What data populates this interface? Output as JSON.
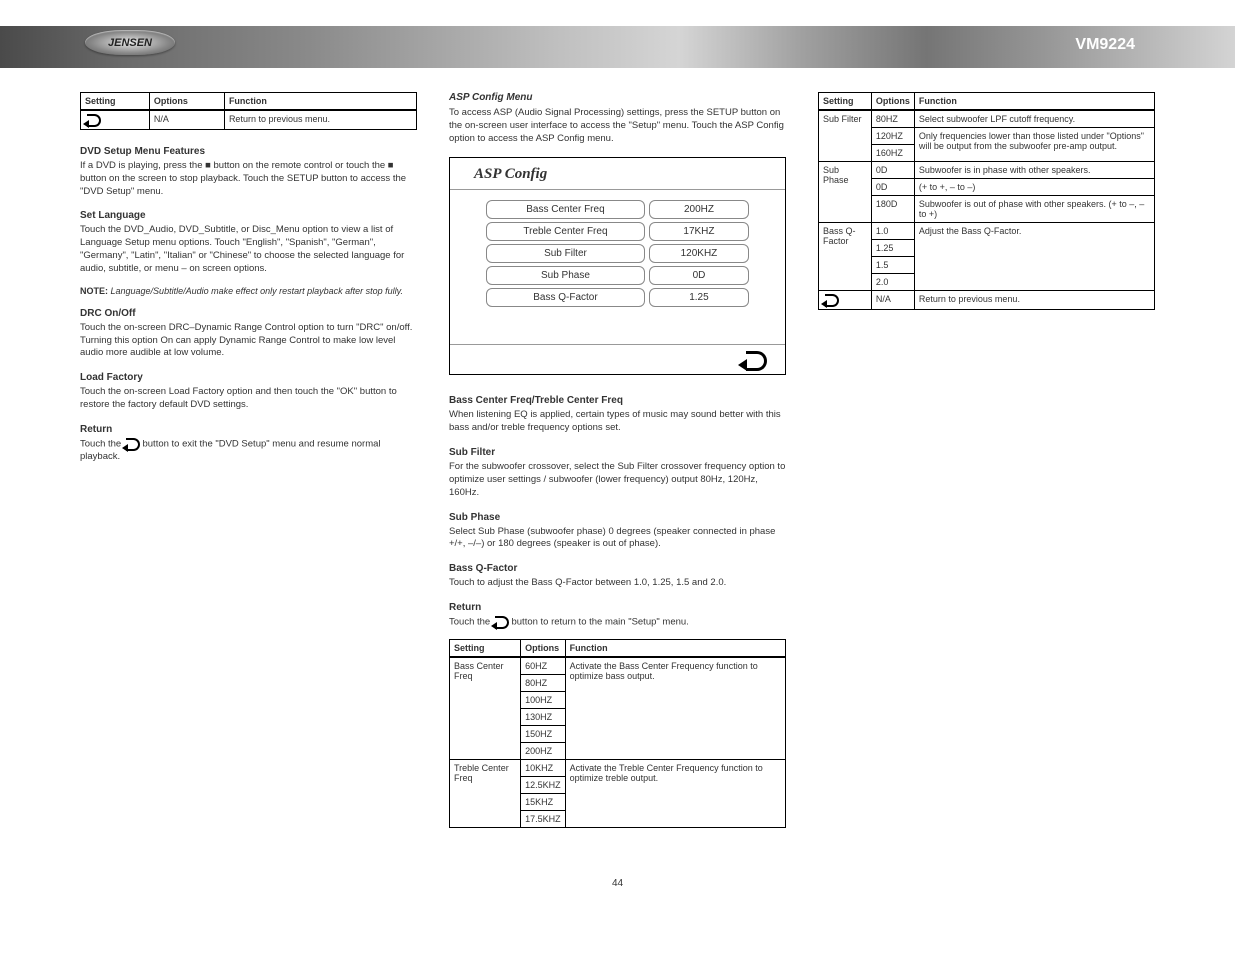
{
  "header": {
    "logo_text": "JENSEN",
    "product_code": "VM9224"
  },
  "page_number": "44",
  "col1": {
    "table_head": {
      "c1": "Setting",
      "c2": "Options",
      "c3": "Function"
    },
    "return_row": {
      "options": "N/A",
      "function": "Return to previous menu."
    },
    "dvd_title": "DVD Setup Menu Features",
    "dvd_intro": "If a DVD is playing, press the ■ button on the remote control or touch the ■ button on the screen to stop playback. Touch the SETUP button to access the \"DVD Setup\" menu.",
    "lang_title": "Set Language",
    "lang_desc": "Touch the DVD_Audio, DVD_Subtitle, or Disc_Menu option to view a list of Language Setup menu options. Touch \"English\", \"Spanish\", \"German\", \"Germany\", \"Latin\", \"Italian\" or \"Chinese\" to choose the selected language for audio, subtitle, or menu – on screen options.",
    "lang_note_label": "NOTE:",
    "lang_note": "Language/Subtitle/Audio make effect only restart playback after stop fully.",
    "drc_title": "DRC On/Off",
    "drc_desc": "Touch the on-screen DRC–Dynamic Range Control option to turn \"DRC\" on/off. Turning this option On can apply Dynamic Range Control to make low level audio more audible at low volume.",
    "load_title": "Load Factory",
    "load_desc": "Touch the on-screen Load Factory option and then touch the \"OK\" button to restore the factory default DVD settings.",
    "return_title": "Return",
    "return_text_1": "Touch the",
    "return_text_2": "button to exit the \"DVD Setup\" menu and resume normal playback."
  },
  "col2": {
    "asp_title_menu": "ASP Config Menu",
    "asp_intro": "To access ASP (Audio Signal Processing) settings, press the SETUP button on the on-screen user interface to access the \"Setup\" menu. Touch the ASP Config option to access the ASP Config menu.",
    "panel_title": "ASP Config",
    "rows": [
      {
        "label": "Bass Center Freq",
        "value": "200HZ"
      },
      {
        "label": "Treble Center Freq",
        "value": "17KHZ"
      },
      {
        "label": "Sub Filter",
        "value": "120KHZ"
      },
      {
        "label": "Sub Phase",
        "value": "0D"
      },
      {
        "label": "Bass Q-Factor",
        "value": "1.25"
      }
    ],
    "bass_title": "Bass Center Freq/Treble Center Freq",
    "bass_desc": "When listening EQ is applied, certain types of music may sound better with this bass and/or treble frequency options set.",
    "sub_title": "Sub Filter",
    "sub_desc": "For the subwoofer crossover, select the Sub Filter crossover frequency option to optimize user settings / subwoofer (lower frequency) output 80Hz, 120Hz, 160Hz.",
    "phase_title": "Sub Phase",
    "phase_desc": "Select Sub Phase (subwoofer phase) 0 degrees (speaker connected in phase +/+, –/–) or 180 degrees (speaker is out of phase).",
    "q_title": "Bass Q-Factor",
    "q_desc": "Touch to adjust the Bass Q-Factor between 1.0, 1.25, 1.5 and 2.0.",
    "return_title": "Return",
    "return_text_1": "Touch the",
    "return_text_2": "button to return to the main \"Setup\" menu.",
    "table_head": {
      "c1": "Setting",
      "c2": "Options",
      "c3": "Function"
    },
    "table_rows": [
      {
        "setting": "Bass Center Freq",
        "cells": [
          {
            "opt": "60HZ",
            "fn": "Activate the Bass Center Frequency function to optimize bass output."
          },
          {
            "opt": "80HZ",
            "fn": ""
          },
          {
            "opt": "100HZ",
            "fn": ""
          },
          {
            "opt": "130HZ",
            "fn": ""
          },
          {
            "opt": "150HZ",
            "fn": ""
          },
          {
            "opt": "200HZ",
            "fn": ""
          }
        ]
      },
      {
        "setting": "Treble Center Freq",
        "cells": [
          {
            "opt": "10KHZ",
            "fn": "Activate the Treble Center Frequency function to optimize treble output."
          },
          {
            "opt": "12.5KHZ",
            "fn": ""
          },
          {
            "opt": "15KHZ",
            "fn": ""
          },
          {
            "opt": "17.5KHZ",
            "fn": ""
          }
        ]
      }
    ]
  },
  "col3": {
    "table_head": {
      "c1": "Setting",
      "c2": "Options",
      "c3": "Function"
    },
    "table_rows": [
      {
        "setting": "Sub Filter",
        "cells": [
          {
            "opt": "80HZ",
            "fn": "Select subwoofer LPF cutoff frequency."
          },
          {
            "opt": "120HZ",
            "fn": ""
          },
          {
            "opt": "160HZ",
            "fn": "Only frequencies lower than those listed under \"Options\" will be output from the subwoofer pre-amp output."
          }
        ]
      },
      {
        "setting": "Sub Phase",
        "cells": [
          {
            "opt": "0D",
            "fn": "Subwoofer is in phase with other speakers."
          },
          {
            "opt": "0D",
            "fn": "(+ to +, – to –)"
          },
          {
            "opt": "180D",
            "fn": "Subwoofer is out of phase with other speakers. (+ to –, – to +)"
          }
        ]
      },
      {
        "setting": "Bass Q-Factor",
        "cells": [
          {
            "opt": "1.0",
            "fn": "Adjust the Bass Q-Factor."
          },
          {
            "opt": "1.25",
            "fn": ""
          },
          {
            "opt": "1.5",
            "fn": ""
          },
          {
            "opt": "2.0",
            "fn": ""
          }
        ]
      }
    ],
    "return_row": {
      "options": "N/A",
      "function": "Return to previous menu."
    }
  }
}
